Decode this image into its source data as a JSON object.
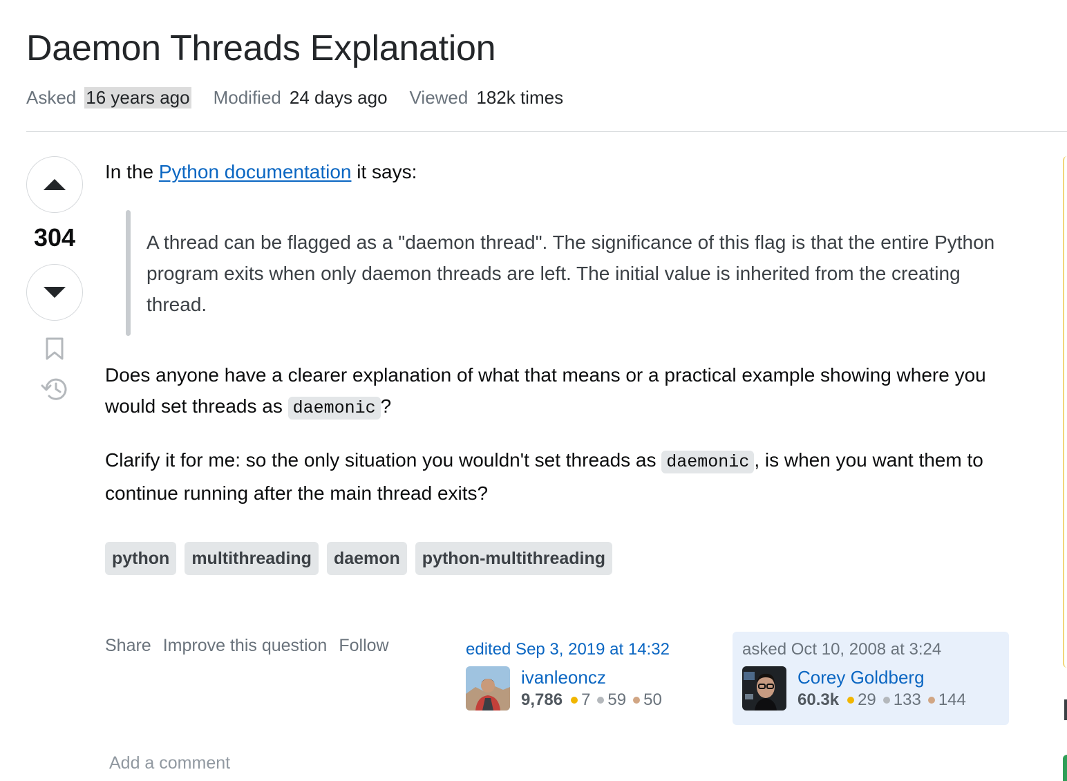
{
  "question": {
    "title": "Daemon Threads Explanation",
    "meta": {
      "asked_label": "Asked",
      "asked_value": "16 years ago",
      "modified_label": "Modified",
      "modified_value": "24 days ago",
      "viewed_label": "Viewed",
      "viewed_value": "182k times"
    },
    "votes": "304",
    "body": {
      "intro_before": "In the ",
      "intro_link": "Python documentation",
      "intro_after": " it says:",
      "quote": "A thread can be flagged as a \"daemon thread\". The significance of this flag is that the entire Python program exits when only daemon threads are left. The initial value is inherited from the creating thread.",
      "para2_before": "Does anyone have a clearer explanation of what that means or a practical example showing where you would set threads as ",
      "para2_code": "daemonic",
      "para2_after": "?",
      "para3_before": "Clarify it for me: so the only situation you wouldn't set threads as ",
      "para3_code": "daemonic",
      "para3_after": ", is when you want them to continue running after the main thread exits?"
    },
    "tags": [
      "python",
      "multithreading",
      "daemon",
      "python-multithreading"
    ],
    "actions": {
      "share": "Share",
      "improve": "Improve this question",
      "follow": "Follow"
    },
    "editor": {
      "when": "edited Sep 3, 2019 at 14:32",
      "name": "ivanleoncz",
      "rep": "9,786",
      "gold": "7",
      "silver": "59",
      "bronze": "50"
    },
    "owner": {
      "when": "asked Oct 10, 2008 at 3:24",
      "name": "Corey Goldberg",
      "rep": "60.3k",
      "gold": "29",
      "silver": "133",
      "bronze": "144"
    },
    "add_comment": "Add a comment"
  },
  "icons": [
    "upvote-icon",
    "downvote-icon",
    "bookmark-icon",
    "history-icon"
  ],
  "colors": {
    "link": "#0a66c2",
    "tag_bg": "#e3e6e8",
    "owner_bg": "#e8f0fb",
    "gold": "#f1b600",
    "silver": "#b4b8bc",
    "bronze": "#d1a684"
  }
}
